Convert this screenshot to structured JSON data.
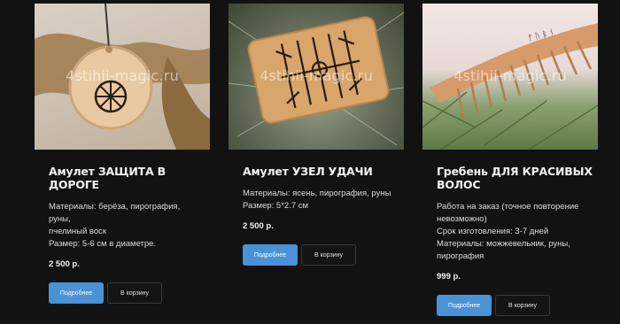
{
  "watermark": "4stihii-magic.ru",
  "buttons": {
    "more": "Подробнее",
    "cart": "В корзину"
  },
  "products": [
    {
      "title": "Амулет ЗАЩИТА В ДОРОГЕ",
      "desc": [
        "Материалы: берёза, пирография, руны,",
        "пчелиный воск",
        "Размер: 5-6 см в диаметре."
      ],
      "price": "2 500 р."
    },
    {
      "title": "Амулет УЗЕЛ УДАЧИ",
      "desc": [
        "Материалы: ясень, пирография, руны",
        "Размер: 5*2.7 см"
      ],
      "price": "2 500 р."
    },
    {
      "title": "Гребень ДЛЯ КРАСИВЫХ ВОЛОС",
      "desc": [
        "Работа на заказ (точное повторение",
        "невозможно)",
        "Срок изготовления: 3-7 дней",
        "Материалы: можжевельник, руны,",
        "пирография"
      ],
      "price": "999 р."
    }
  ],
  "colors": {
    "background": "#121212",
    "accent": "#4a92d6"
  }
}
